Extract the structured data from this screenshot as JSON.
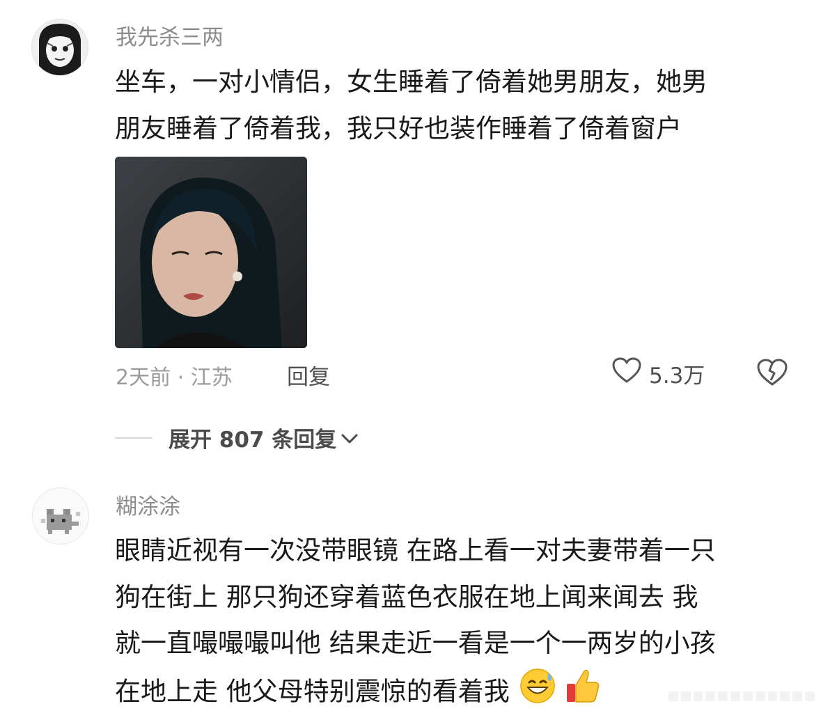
{
  "comment1": {
    "username": "我先杀三两",
    "line1": "坐车，一对小情侣，女生睡着了倚着她男朋友，她男",
    "line2": "朋友睡着了倚着我，我只好也装作睡着了倚着窗户",
    "meta": "2天前 · 江苏",
    "reply_label": "回复",
    "like_count": "5.3万"
  },
  "expand": {
    "label": "展开 807 条回复"
  },
  "comment2": {
    "username": "糊涂涂",
    "line1": "眼睛近视有一次没带眼镜 在路上看一对夫妻带着一只",
    "line2": "狗在街上 那只狗还穿着蓝色衣服在地上闻来闻去 我",
    "line3": "就一直嘬嘬嘬叫他 结果走近一看是一个一两岁的小孩",
    "line4": "在地上走 他父母特别震惊的看着我"
  },
  "icons": {
    "like": "heart-outline-icon",
    "dislike": "broken-heart-icon",
    "expand": "chevron-down-icon",
    "emoji1": "grinning-sweat-face-icon",
    "emoji2": "thumbs-up-icon"
  }
}
